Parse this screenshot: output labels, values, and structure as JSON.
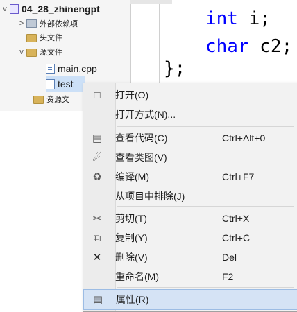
{
  "explorer": {
    "project": "04_28_zhinengpt",
    "nodes": [
      {
        "label": "外部依赖项",
        "icon": "external-deps-icon"
      },
      {
        "label": "头文件",
        "icon": "folder-icon"
      },
      {
        "label": "源文件",
        "icon": "folder-icon"
      },
      {
        "label": "main.cpp",
        "icon": "cpp-file-icon"
      },
      {
        "label": "test",
        "icon": "cpp-file-icon"
      },
      {
        "label": "资源文",
        "icon": "folder-icon"
      }
    ]
  },
  "editor": {
    "line1_keyword": "int",
    "line1_rest": " i;",
    "line2_keyword": "char",
    "line2_rest": " c2;",
    "closing": "};"
  },
  "context_menu": {
    "items": [
      {
        "label": "打开(O)",
        "shortcut": "",
        "icon": "open-file-icon"
      },
      {
        "label": "打开方式(N)...",
        "shortcut": "",
        "icon": ""
      },
      {
        "label": "查看代码(C)",
        "shortcut": "Ctrl+Alt+0",
        "icon": "view-code-icon"
      },
      {
        "label": "查看类图(V)",
        "shortcut": "",
        "icon": "class-diagram-icon"
      },
      {
        "label": "编译(M)",
        "shortcut": "Ctrl+F7",
        "icon": "compile-icon"
      },
      {
        "label": "从项目中排除(J)",
        "shortcut": "",
        "icon": ""
      },
      {
        "label": "剪切(T)",
        "shortcut": "Ctrl+X",
        "icon": "cut-icon"
      },
      {
        "label": "复制(Y)",
        "shortcut": "Ctrl+C",
        "icon": "copy-icon"
      },
      {
        "label": "删除(V)",
        "shortcut": "Del",
        "icon": "delete-icon"
      },
      {
        "label": "重命名(M)",
        "shortcut": "F2",
        "icon": ""
      },
      {
        "label": "属性(R)",
        "shortcut": "",
        "icon": "properties-icon"
      }
    ]
  },
  "colors": {
    "keyword": "#0000ff",
    "menu_bg": "#f2f2f2",
    "hover_bg": "#d5e3f5"
  }
}
